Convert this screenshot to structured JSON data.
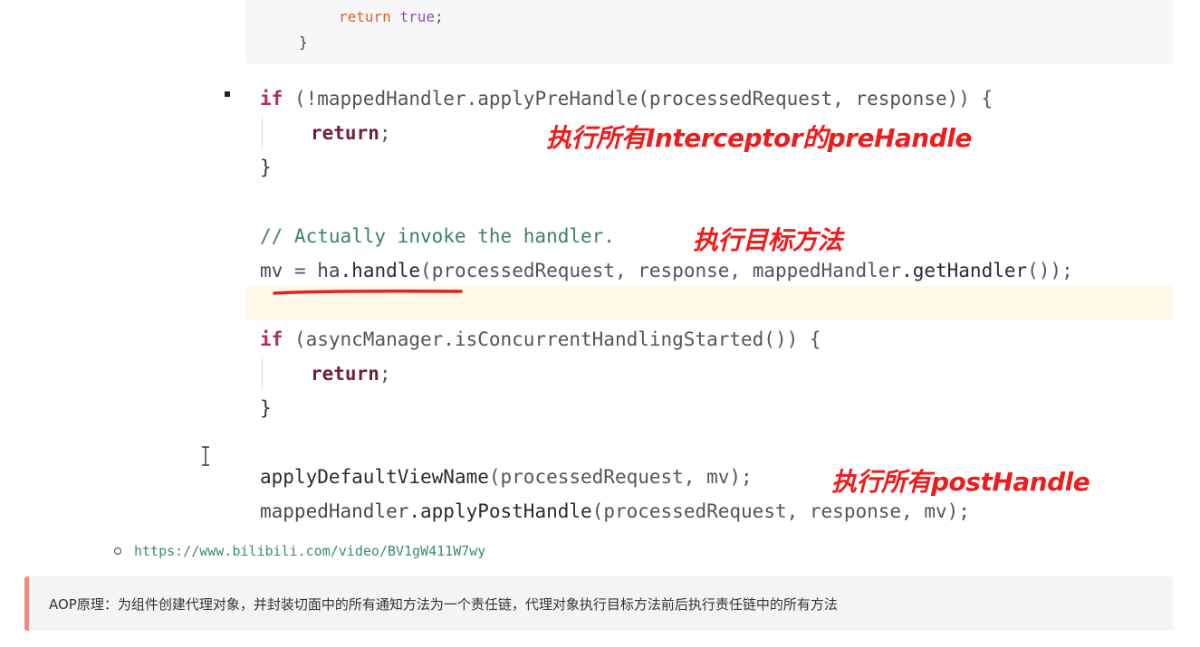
{
  "top_code": {
    "return_kw": "return",
    "true_kw": "true",
    "semicolon": ";",
    "close_brace": "}"
  },
  "code": {
    "line1": {
      "if_kw": "if",
      "rest": " (!mappedHandler.applyPreHandle(processedRequest, response)) {"
    },
    "line2": {
      "return_kw": "return",
      "semicolon": ";"
    },
    "line3": "}",
    "comment": "// Actually invoke the handler.",
    "line5": {
      "mv": "mv",
      "eq": " = ",
      "ha": "ha",
      "handle": ".handle",
      "args": "(processedRequest, response, mappedHandler",
      "getHandler": ".getHandler",
      "tail": "());"
    },
    "line6": {
      "if_kw": "if",
      "rest": " (asyncManager.isConcurrentHandlingStarted()) {"
    },
    "line7": {
      "return_kw": "return",
      "semicolon": ";"
    },
    "line8": "}",
    "line9": {
      "method": "applyDefaultViewName",
      "args": "(processedRequest, mv);"
    },
    "line10": {
      "obj": "mappedHandler",
      "method": ".applyPostHandle",
      "args": "(processedRequest, response, mv);"
    }
  },
  "annotations": {
    "prehandle": "执行所有Interceptor的preHandle",
    "target": "执行目标方法",
    "posthandle": "执行所有postHandle"
  },
  "link": {
    "url": "https://www.bilibili.com/video/BV1gW411W7wy"
  },
  "note": {
    "text": "AOP原理：为组件创建代理对象，并封装切面中的所有通知方法为一个责任链，代理对象执行目标方法前后执行责任链中的所有方法"
  },
  "colors": {
    "annotation": "#ee1c1c",
    "keyword": "#b02a5a",
    "comment": "#3f7f6c",
    "link": "#3d8b6e",
    "note_border": "#f08a7e"
  }
}
